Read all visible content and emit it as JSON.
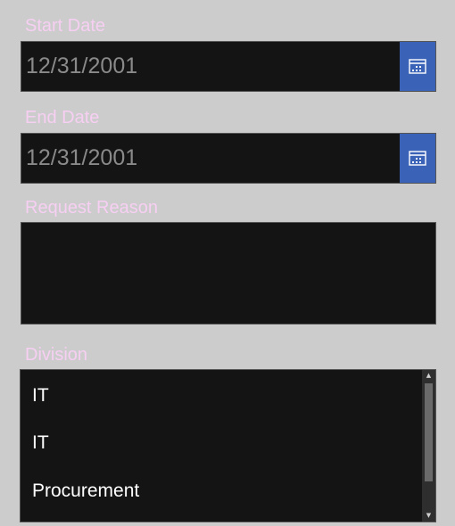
{
  "form": {
    "start_date": {
      "label": "Start Date",
      "value": "12/31/2001",
      "picker_icon": "calendar-icon"
    },
    "end_date": {
      "label": "End Date",
      "value": "12/31/2001",
      "picker_icon": "calendar-icon"
    },
    "request_reason": {
      "label": "Request Reason",
      "value": ""
    },
    "division": {
      "label": "Division",
      "options": [
        "IT",
        "IT",
        "Procurement"
      ]
    }
  },
  "colors": {
    "background": "#cccccc",
    "label": "#f6cff2",
    "field_background": "#141414",
    "accent": "#3a63b8",
    "date_text": "#8a8a8a",
    "list_text": "#ffffff"
  }
}
